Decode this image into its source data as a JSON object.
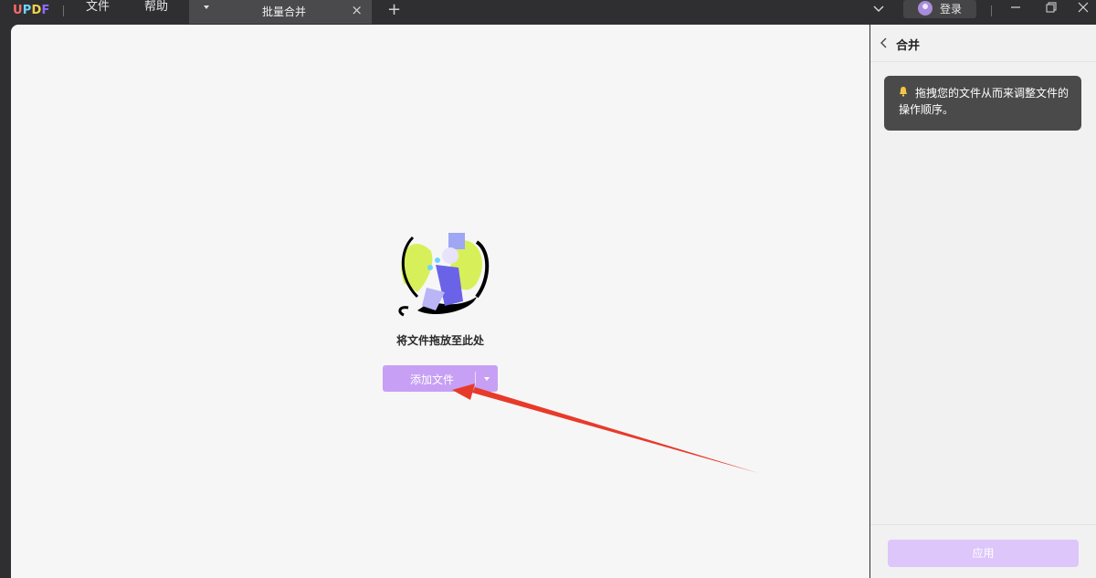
{
  "app": {
    "logo": "UPDF"
  },
  "menu": {
    "file": "文件",
    "help": "帮助"
  },
  "tab": {
    "title": "批量合并",
    "close_icon": "×"
  },
  "login": {
    "label": "登录"
  },
  "main": {
    "drop_text": "将文件拖放至此处",
    "add_button_label": "添加文件",
    "accent_color": "#c7a0f5"
  },
  "panel": {
    "title": "合并",
    "tip": {
      "line1": "拖拽您的文件从而来调整文件的",
      "line2": "操作顺序。"
    },
    "apply_label": "应用"
  }
}
